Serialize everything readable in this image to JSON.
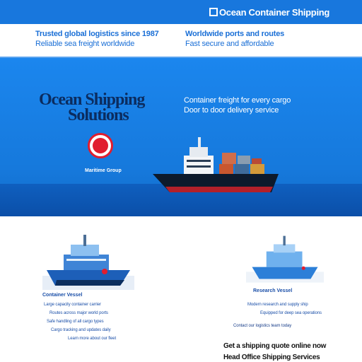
{
  "header": {
    "title": "Ocean Container Shipping"
  },
  "intro": {
    "left_line1": "Trusted global logistics since 1987",
    "left_line2": "Reliable sea freight worldwide",
    "right_line1": "Worldwide ports and routes",
    "right_line2": "Fast secure and affordable"
  },
  "hero": {
    "heading_line1": "Ocean Shipping",
    "heading_line2": "Solutions",
    "side_line1": "Container freight for every cargo",
    "side_line2": "Door to door delivery service",
    "brand_caption": "Maritime Group"
  },
  "cards": [
    {
      "name": "Container Vessel",
      "caption_lines": [
        "Large capacity container carrier",
        "Routes across major world ports",
        "Safe handling of all cargo types",
        "Cargo tracking and updates daily",
        "Learn more about our fleet"
      ]
    },
    {
      "name": "Research Vessel",
      "caption_lines": [
        "Modern research and supply ship",
        "Equipped for deep sea operations"
      ]
    }
  ],
  "footer": {
    "contact_line1": "Contact our logistics team today",
    "contact_line2": "Get a shipping quote online now",
    "contact_line3": "Head Office  Shipping Services"
  },
  "colors": {
    "brand_blue": "#1877dd",
    "hero_blue": "#1b86ee",
    "accent_red": "#e11d2e",
    "heading_navy": "#0b2c5f"
  }
}
